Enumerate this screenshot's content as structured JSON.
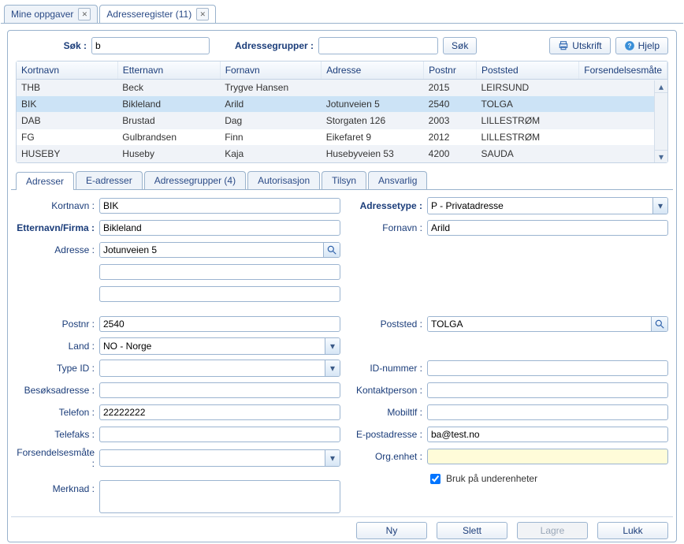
{
  "top_tabs": [
    {
      "label": "Mine oppgaver",
      "active": false
    },
    {
      "label": "Adresseregister (11)",
      "active": true
    }
  ],
  "search": {
    "label": "Søk :",
    "value": "b",
    "group_label": "Adressegrupper :",
    "group_value": "",
    "button": "Søk"
  },
  "actions": {
    "print": "Utskrift",
    "help": "Hjelp"
  },
  "grid": {
    "columns": [
      "Kortnavn",
      "Etternavn",
      "Fornavn",
      "Adresse",
      "Postnr",
      "Poststed",
      "Forsendelsesmåte"
    ],
    "rows": [
      {
        "cells": [
          "THB",
          "Beck",
          "Trygve Hansen",
          "",
          "2015",
          "LEIRSUND",
          ""
        ],
        "selected": false
      },
      {
        "cells": [
          "BIK",
          "Bikleland",
          "Arild",
          "Jotunveien 5",
          "2540",
          "TOLGA",
          ""
        ],
        "selected": true
      },
      {
        "cells": [
          "DAB",
          "Brustad",
          "Dag",
          "Storgaten 126",
          "2003",
          "LILLESTRØM",
          ""
        ],
        "selected": false
      },
      {
        "cells": [
          "FG",
          "Gulbrandsen",
          "Finn",
          "Eikefaret 9",
          "2012",
          "LILLESTRØM",
          ""
        ],
        "selected": false
      },
      {
        "cells": [
          "HUSEBY",
          "Huseby",
          "Kaja",
          "Husebyveien 53",
          "4200",
          "SAUDA",
          ""
        ],
        "selected": false
      }
    ]
  },
  "inner_tabs": [
    {
      "label": "Adresser",
      "active": true
    },
    {
      "label": "E-adresser",
      "active": false
    },
    {
      "label": "Adressegrupper (4)",
      "active": false
    },
    {
      "label": "Autorisasjon",
      "active": false
    },
    {
      "label": "Tilsyn",
      "active": false
    },
    {
      "label": "Ansvarlig",
      "active": false
    }
  ],
  "form": {
    "kortnavn_label": "Kortnavn :",
    "kortnavn": "BIK",
    "etternavn_label": "Etternavn/Firma :",
    "etternavn": "Bikleland",
    "adresse_label": "Adresse :",
    "adresse1": "Jotunveien 5",
    "adresse2": "",
    "adresse3": "",
    "postnr_label": "Postnr :",
    "postnr": "2540",
    "land_label": "Land :",
    "land": "NO - Norge",
    "typeid_label": "Type ID :",
    "typeid": "",
    "besok_label": "Besøksadresse :",
    "besok": "",
    "telefon_label": "Telefon :",
    "telefon": "22222222",
    "telefaks_label": "Telefaks :",
    "telefaks": "",
    "forsend_label": "Forsendelsesmåte :",
    "forsend": "",
    "merknad_label": "Merknad :",
    "merknad": "",
    "adresstype_label": "Adressetype :",
    "adresstype": "P - Privatadresse",
    "fornavn_label": "Fornavn :",
    "fornavn": "Arild",
    "poststed_label": "Poststed :",
    "poststed": "TOLGA",
    "idnummer_label": "ID-nummer :",
    "idnummer": "",
    "kontakt_label": "Kontaktperson :",
    "kontakt": "",
    "mobil_label": "Mobiltlf :",
    "mobil": "",
    "epost_label": "E-postadresse :",
    "epost": "ba@test.no",
    "orgenhet_label": "Org.enhet :",
    "orgenhet": "",
    "underenhet_label": "Bruk på underenheter"
  },
  "footer": {
    "ny": "Ny",
    "slett": "Slett",
    "lagre": "Lagre",
    "lukk": "Lukk"
  }
}
